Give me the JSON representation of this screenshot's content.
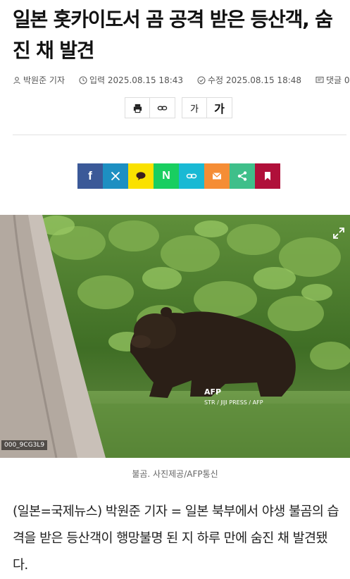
{
  "article": {
    "title": "일본 홋카이도서 곰 공격 받은 등산객, 숨진 채 발견",
    "meta": {
      "author": "박원준 기자",
      "published": "입력 2025.08.15 18:43",
      "modified": "수정 2025.08.15 18:48",
      "comments": "댓글 0"
    },
    "tools": {
      "print_icon": "print-icon",
      "link_icon": "link-icon",
      "font_small": "가",
      "font_large": "가"
    },
    "share": [
      {
        "name": "facebook",
        "label": "f",
        "color": "#3b5998"
      },
      {
        "name": "x",
        "label": "𝕏",
        "color": "#1d8fc2"
      },
      {
        "name": "kakaotalk",
        "label": "💬",
        "color": "#fae100"
      },
      {
        "name": "naver",
        "label": "N",
        "color": "#19ce60"
      },
      {
        "name": "link",
        "label": "🔗",
        "color": "#19b9d4"
      },
      {
        "name": "email",
        "label": "✉",
        "color": "#f58d35"
      },
      {
        "name": "share",
        "label": "share",
        "color": "#3fbf8a"
      },
      {
        "name": "bookmark",
        "label": "bookmark",
        "color": "#b0103a"
      }
    ],
    "photo": {
      "code": "000_9CG3L9",
      "credit_logo": "AFP",
      "credit": "STR / JIJI PRESS / AFP"
    },
    "caption": "불곰. 사진제공/AFP통신",
    "body": "(일본=국제뉴스) 박원준 기자 = 일본 북부에서 야생 불곰의 습격을 받은 등산객이 행망불명 된 지 하루 만에 숨진 채 발견됐다."
  }
}
